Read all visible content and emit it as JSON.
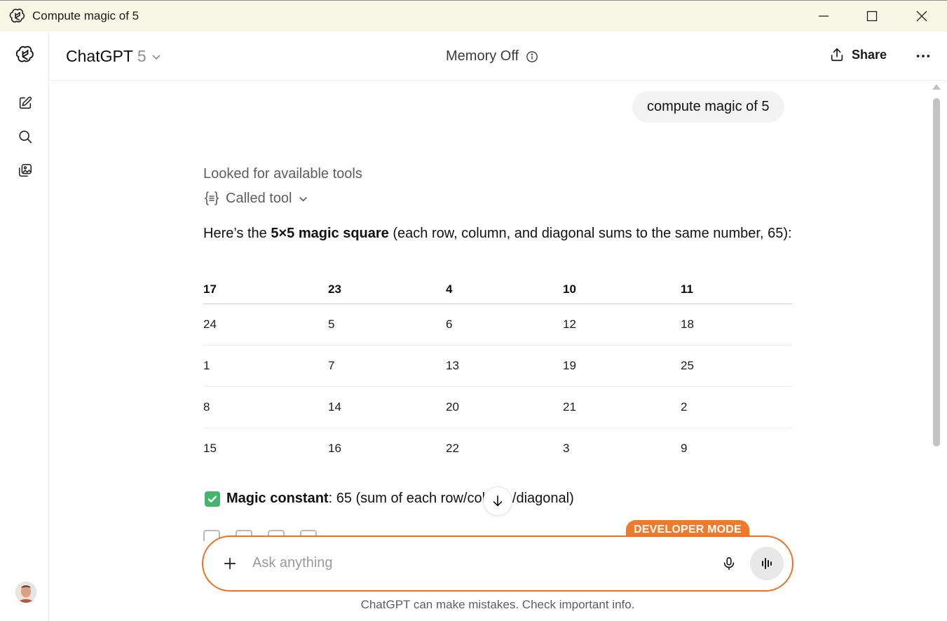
{
  "window": {
    "title": "Compute magic of 5"
  },
  "header": {
    "model_name": "ChatGPT",
    "model_version": "5",
    "memory_label": "Memory Off",
    "share_label": "Share"
  },
  "chat": {
    "user_message": "compute magic of 5",
    "tool_status_1": "Looked for available tools",
    "tool_status_2": "Called tool",
    "intro_prefix": "Here’s the ",
    "intro_bold": "5×5 magic square",
    "intro_suffix": " (each row, column, and diagonal sums to the same number, 65):",
    "table": {
      "header": [
        "17",
        "23",
        "4",
        "10",
        "11"
      ],
      "rows": [
        [
          "24",
          "5",
          "6",
          "12",
          "18"
        ],
        [
          "1",
          "7",
          "13",
          "19",
          "25"
        ],
        [
          "8",
          "14",
          "20",
          "21",
          "2"
        ],
        [
          "15",
          "16",
          "22",
          "3",
          "9"
        ]
      ]
    },
    "constant_label": "Magic constant",
    "constant_text": ": 65 (sum of each row/column/diagonal)"
  },
  "composer": {
    "badge": "DEVELOPER MODE",
    "placeholder": "Ask anything"
  },
  "footer": {
    "disclaimer": "ChatGPT can make mistakes. Check important info."
  },
  "colors": {
    "accent": "#ef6f22",
    "titlebar": "#f6f7e4",
    "check": "#44b46e"
  }
}
